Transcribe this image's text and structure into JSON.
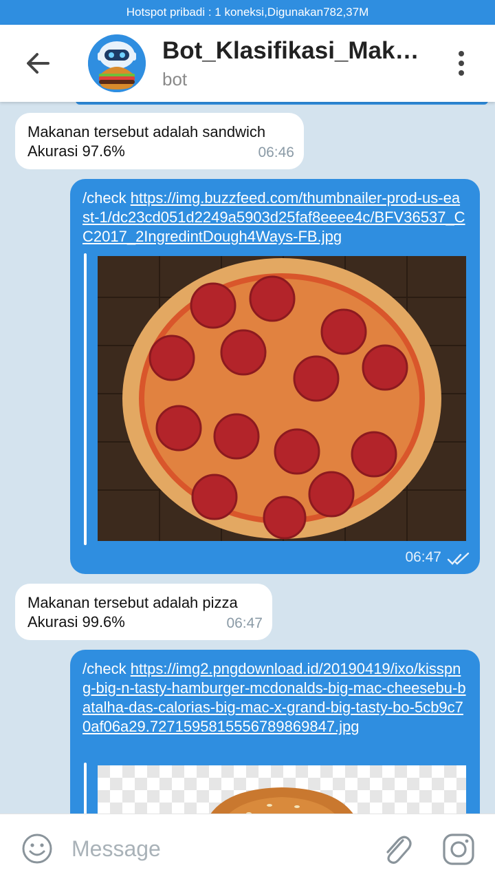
{
  "status": {
    "text": "Hotspot pribadi : 1 koneksi,Digunakan782,37M"
  },
  "header": {
    "title": "Bot_Klasifikasi_Makanan",
    "subtitle": "bot"
  },
  "messages": [
    {
      "direction": "in",
      "lines": [
        "Makanan tersebut adalah sandwich",
        "Akurasi 97.6%"
      ],
      "time": "06:46"
    },
    {
      "direction": "out",
      "command": "/check",
      "link": "https://img.buzzfeed.com/thumbnailer-prod-us-east-1/dc23cd051d2249a5903d25faf8eeee4c/BFV36537_CC2017_2IngredintDough4Ways-FB.jpg",
      "image": "pizza-preview",
      "time": "06:47",
      "status": "read"
    },
    {
      "direction": "in",
      "lines": [
        "Makanan tersebut adalah pizza",
        "Akurasi 99.6%"
      ],
      "time": "06:47"
    },
    {
      "direction": "out",
      "command": "/check",
      "link": "https://img2.pngdownload.id/20190419/ixo/kisspng-big-n-tasty-hamburger-mcdonalds-big-mac-cheesebu-batalha-das-calorias-big-mac-x-grand-big-tasty-bo-5cb9c70af06a29.7271595815556789869847.jpg",
      "image": "burger-preview"
    }
  ],
  "input": {
    "placeholder": "Message"
  },
  "icons": {
    "back": "arrow-left-icon",
    "menu": "more-vertical-icon",
    "emoji": "emoji-icon",
    "attach": "paperclip-icon",
    "camera": "camera-icon",
    "read": "double-check-icon"
  },
  "colors": {
    "accent": "#2f8ee0",
    "background": "#d4e3ee"
  }
}
